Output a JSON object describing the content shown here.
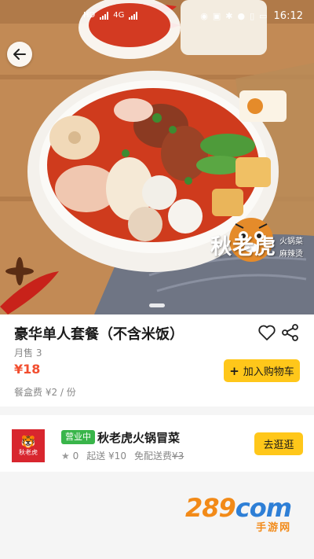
{
  "status_bar": {
    "carrier_left": "HD",
    "carrier_right": "4G",
    "time": "16:12"
  },
  "hero": {
    "brand_name": "秋老虎",
    "brand_tag_1": "火锅菜",
    "brand_tag_2": "麻辣烫"
  },
  "product": {
    "title": "豪华单人套餐（不含米饭）",
    "monthly_sales": "月售 3",
    "price": "¥18",
    "box_fee": "餐盒费 ¥2 / 份",
    "add_to_cart_label": "加入购物车",
    "add_icon": "+"
  },
  "store": {
    "logo_text": "秋老虎",
    "status_badge": "营业中",
    "name": "秋老虎火锅冒菜",
    "rating": "0",
    "min_order": "起送 ¥10",
    "delivery_prefix": "免配送费",
    "delivery_original": "¥3",
    "visit_label": "去逛逛"
  },
  "watermark": {
    "digits": "289",
    "suffix": "com",
    "sub": "手游网"
  },
  "colors": {
    "accent_yellow": "#ffc71a",
    "price_red": "#f24e2f",
    "open_green": "#39b54a",
    "logo_red": "#d8262e"
  },
  "icons": {
    "back": "back-arrow-icon",
    "favorite": "heart-icon",
    "share": "share-icon",
    "star": "star-icon"
  }
}
